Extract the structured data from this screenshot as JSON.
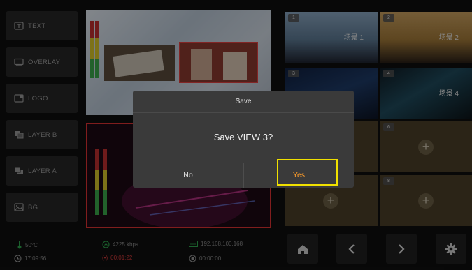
{
  "layers": [
    {
      "label": "TEXT",
      "icon": "text-layer-icon"
    },
    {
      "label": "OVERLAY",
      "icon": "overlay-icon"
    },
    {
      "label": "LOGO",
      "icon": "logo-layer-icon"
    },
    {
      "label": "LAYER B",
      "icon": "layer-b-icon"
    },
    {
      "label": "LAYER A",
      "icon": "layer-a-icon"
    },
    {
      "label": "BG",
      "icon": "image-icon"
    }
  ],
  "views": [
    {
      "number": "1",
      "label": "场景 1"
    },
    {
      "number": "2",
      "label": "场景 2"
    },
    {
      "number": "3",
      "label": ""
    },
    {
      "number": "4",
      "label": "场景 4"
    },
    {
      "number": "5",
      "label": ""
    },
    {
      "number": "6",
      "label": ""
    },
    {
      "number": "7",
      "label": ""
    },
    {
      "number": "8",
      "label": ""
    }
  ],
  "status": {
    "temperature": "50°C",
    "clock": "17:09:56",
    "bitrate": "4225 kbps",
    "live_time": "00:01:22",
    "ip_address": "192.168.100.168",
    "record_time": "00:00:00"
  },
  "dialog": {
    "title": "Save",
    "message": "Save VIEW 3?",
    "no_label": "No",
    "yes_label": "Yes"
  },
  "colors": {
    "accent_orange": "#ff9d2a",
    "focus_yellow": "#f0e000",
    "status_green": "#2fa84f",
    "live_red": "#d23a3a"
  }
}
